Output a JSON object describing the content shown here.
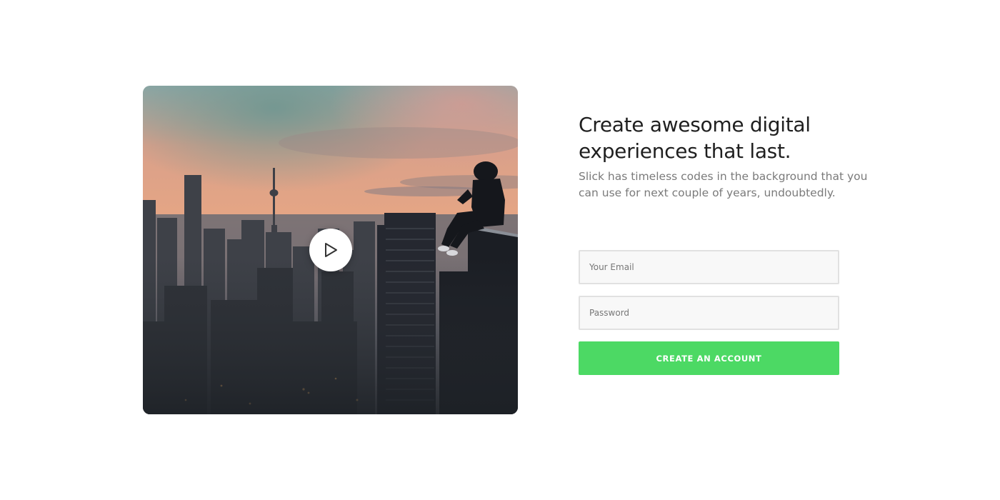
{
  "hero": {
    "headline": "Create awesome digital experiences that last.",
    "subtext": "Slick has timeless codes in the background that you can use for next couple of years, undoubtedly.",
    "play_icon": "play-icon"
  },
  "form": {
    "email_placeholder": "Your Email",
    "password_placeholder": "Password",
    "submit_label": "CREATE AN ACCOUNT"
  },
  "colors": {
    "accent": "#4cd964",
    "heading": "#1f1f1f",
    "body_text": "#7a7a7a",
    "field_bg": "#f8f8f8",
    "field_border": "#e1e1e1"
  }
}
